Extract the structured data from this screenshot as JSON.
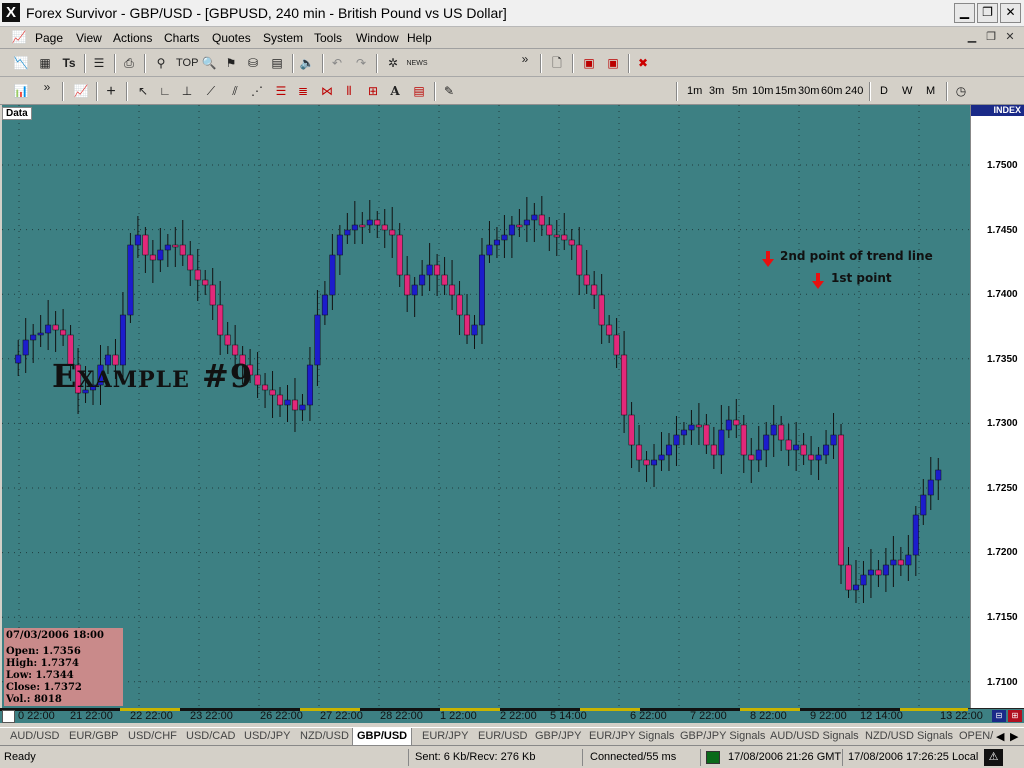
{
  "window": {
    "title": "Forex Survivor - GBP/USD - [GBPUSD, 240 min - British Pound vs US Dollar]",
    "app_icon": "X",
    "minimize": "▁",
    "restore": "❐",
    "close": "✕"
  },
  "menu": {
    "items": [
      "Page",
      "View",
      "Actions",
      "Charts",
      "Quotes",
      "System",
      "Tools",
      "Window",
      "Help"
    ],
    "more": "»"
  },
  "toolbar": {
    "top_label": "TOP",
    "news_label": "NEWS",
    "more": "»"
  },
  "timeframes": [
    "1m",
    "3m",
    "5m",
    "10m",
    "15m",
    "30m",
    "60m",
    "240",
    "D",
    "W",
    "M"
  ],
  "chart": {
    "data_tag": "Data",
    "example_label": "Example #9",
    "annotation_2nd": "2nd point of trend line",
    "annotation_1st": "1st point",
    "index_label": "INDEX",
    "price_labels": [
      "1.7500",
      "1.7450",
      "1.7400",
      "1.7350",
      "1.7300",
      "1.7250",
      "1.7200",
      "1.7150",
      "1.7100"
    ],
    "time_labels": [
      "0 22:00",
      "21 22:00",
      "22 22:00",
      "23 22:00",
      "26 22:00",
      "27 22:00",
      "28 22:00",
      "1 22:00",
      "2 22:00",
      "5 14:00",
      "6 22:00",
      "7 22:00",
      "8 22:00",
      "9 22:00",
      "12 14:00",
      "13 22:00"
    ],
    "colors": {
      "background": "#3d8083",
      "bull": "#1c1ccc",
      "bear": "#e2287a",
      "wick": "#111111"
    }
  },
  "info_box": {
    "date": "07/03/2006 18:00",
    "open": "Open: 1.7356",
    "high": "High: 1.7374",
    "low": "Low: 1.7344",
    "close": "Close: 1.7372",
    "vol": "Vol.: 8018"
  },
  "tabs": [
    "AUD/USD",
    "EUR/GBP",
    "USD/CHF",
    "USD/CAD",
    "USD/JPY",
    "NZD/USD",
    "GBP/USD",
    "EUR/JPY",
    "EUR/USD",
    "GBP/JPY",
    "EUR/JPY Signals",
    "GBP/JPY Signals",
    "AUD/USD Signals",
    "NZD/USD Signals",
    "OPEN/"
  ],
  "active_tab": "GBP/USD",
  "status": {
    "ready": "Ready",
    "traffic": "Sent: 6 Kb/Recv: 276 Kb",
    "connection": "Connected/55 ms",
    "gmt_time": "17/08/2006 21:26 GMT",
    "local_time": "17/08/2006 17:26:25 Local"
  }
}
